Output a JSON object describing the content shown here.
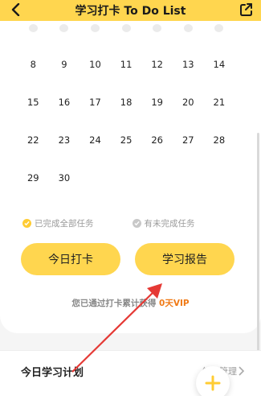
{
  "header": {
    "title": "学习打卡 To Do List",
    "back_icon": "chevron-left-icon",
    "share_icon": "share-icon"
  },
  "calendar": {
    "rows": [
      [
        "",
        "",
        "",
        "",
        "",
        "",
        ""
      ],
      [
        "8",
        "9",
        "10",
        "11",
        "12",
        "13",
        "14"
      ],
      [
        "15",
        "16",
        "17",
        "18",
        "19",
        "20",
        "21"
      ],
      [
        "22",
        "23",
        "24",
        "25",
        "26",
        "27",
        "28"
      ],
      [
        "29",
        "30"
      ]
    ],
    "today": "25"
  },
  "legend": {
    "completed_all": "已完成全部任务",
    "has_incomplete": "有未完成任务"
  },
  "buttons": {
    "checkin": "今日打卡",
    "report": "学习报告"
  },
  "vip_note": {
    "prefix": "您已通过打卡累计获得",
    "value": "0天VIP"
  },
  "plan": {
    "title": "今日学习计划",
    "manage": "任务管理"
  },
  "colors": {
    "brand": "#ffd64f",
    "accent": "#ffcc33",
    "vip": "#f07a16",
    "annotation": "#e53935"
  }
}
